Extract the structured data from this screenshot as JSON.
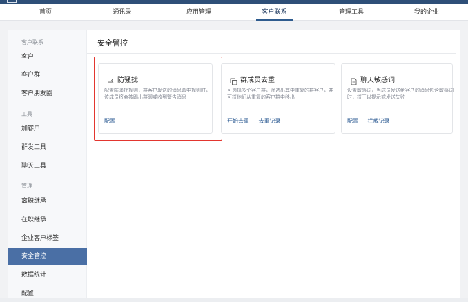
{
  "nav": {
    "items": [
      {
        "label": "首页"
      },
      {
        "label": "通讯录"
      },
      {
        "label": "应用管理"
      },
      {
        "label": "客户联系"
      },
      {
        "label": "管理工具"
      },
      {
        "label": "我的企业"
      }
    ],
    "active": "客户联系"
  },
  "sidebar": {
    "groups": [
      {
        "label": "客户联系"
      },
      {
        "label": "工具"
      },
      {
        "label": "管理"
      }
    ],
    "items": [
      {
        "label": "客户"
      },
      {
        "label": "客户群"
      },
      {
        "label": "客户朋友圈"
      },
      {
        "label": "加客户"
      },
      {
        "label": "群发工具"
      },
      {
        "label": "聊天工具"
      },
      {
        "label": "离职继承"
      },
      {
        "label": "在职继承"
      },
      {
        "label": "企业客户标签"
      },
      {
        "label": "安全管控"
      },
      {
        "label": "数据统计"
      },
      {
        "label": "配置"
      }
    ],
    "active": "安全管控"
  },
  "main": {
    "title": "安全管控",
    "cards": [
      {
        "title": "防骚扰",
        "icon": "flag-icon",
        "desc": "配置防骚扰规则，群客户发送的消息命中规则时，该成员将会被踢出群聊或收到警告消息",
        "links": [
          "配置"
        ]
      },
      {
        "title": "群成员去重",
        "icon": "copy-icon",
        "desc": "可选择多个客户群，筛选出其中重复的群客户，并可将他们从重复的客户群中移出",
        "links": [
          "开始去重",
          "去重记录"
        ]
      },
      {
        "title": "聊天敏感词",
        "icon": "document-icon",
        "desc": "设置敏感词，当成员发送给客户的消息包含敏感词时，将于以提示或发送失败",
        "links": [
          "配置",
          "拦截记录"
        ]
      }
    ]
  },
  "colors": {
    "topbar": "#2e4f78",
    "accent": "#4a6fa5",
    "link": "#2f5d94",
    "highlight": "#e3362f"
  }
}
